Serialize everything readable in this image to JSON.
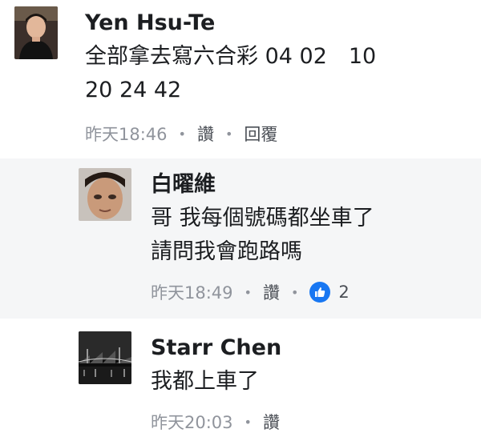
{
  "comments": [
    {
      "author": "Yen Hsu-Te",
      "text": "全部拿去寫六合彩 04 02　10\n20 24 42",
      "time": "昨天18:46",
      "like_label": "讚",
      "reply_label": "回覆"
    },
    {
      "author": "白曜維",
      "text": "哥 我每個號碼都坐車了\n請問我會跑路嗎",
      "time": "昨天18:49",
      "like_label": "讚",
      "reaction_count": "2"
    },
    {
      "author": "Starr Chen",
      "text": "我都上車了",
      "time": "昨天20:03",
      "like_label": "讚"
    }
  ],
  "colors": {
    "like_blue": "#1877f2",
    "meta_gray": "#90949c",
    "reply_bg": "#f5f6f7"
  },
  "icons": [
    "thumbs-up-icon"
  ]
}
